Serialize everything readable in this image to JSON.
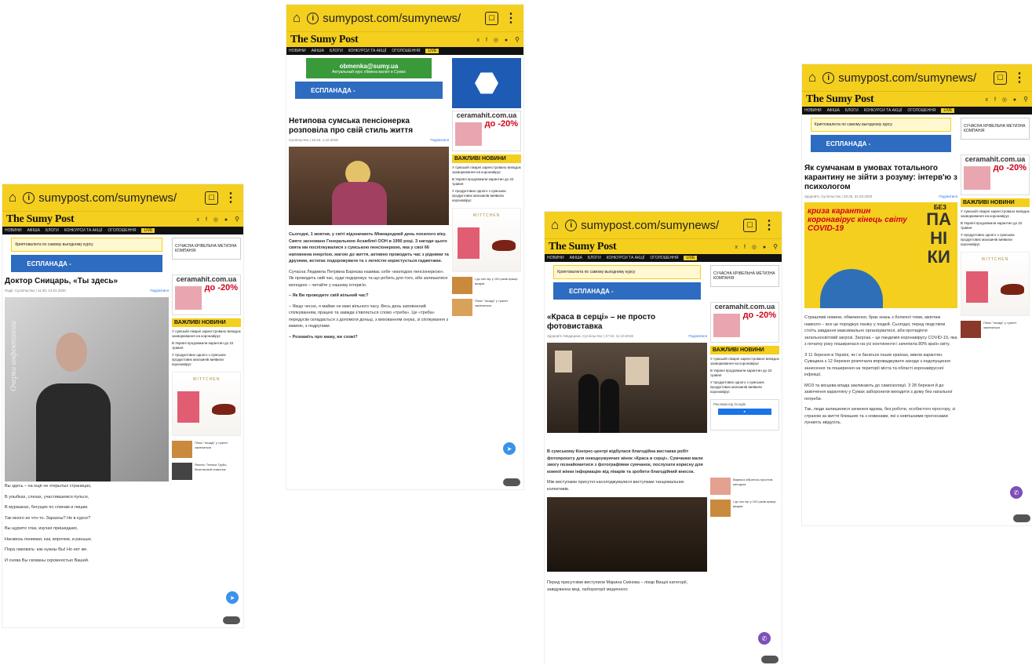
{
  "browser": {
    "url": "sumypost.com/sumynews/",
    "tab_count": " "
  },
  "site": {
    "logo": "The Sumy Post",
    "social": "х f ◎ ●",
    "nav": [
      "НОВИНИ",
      "АФІША",
      "БЛОГИ",
      "КОНКУРСИ ТА АКЦІЇ",
      "ОГОЛОШЕННЯ"
    ],
    "live": "LIVE",
    "important_news": "ВАЖЛИВІ НОВИНИ",
    "ads": {
      "obmenka": "obmenka@sumy.ua",
      "obmenka_sub": "Актуальный курс обмена валют в Сумах",
      "esplanada": "ЕСПЛАНАДА -",
      "ceramahit": "ceramahit.com.ua",
      "sale": "до -20%",
      "sale_sub": "на ВСЕ ДЛЯ ВАННОЇ КІМНАТИ",
      "sucasna": "СУЧАСНА КРІВЕЛЬНА МЕТИЗНА КОМПАНІЯ",
      "crypto": "Криптовалюта по самому выгодному курсу",
      "wittchen": "WITTCHEN"
    },
    "news_items": [
      "У сумській лікарні зареєстровано випадок захворювання на коронавірус",
      "В Україні продовжили карантин до 22 травня",
      "У продуктових одного з сумських продуктових магазинів виявили коронавірус"
    ]
  },
  "phones": [
    {
      "title": "Доктор Сницарь, «Ты здесь»",
      "meta": "Події, Суспільство | 11:30, 14.01.2020",
      "share": "Поділитися",
      "photo_caption": "Очерки инфектолога",
      "lines": [
        "Вы здесь – на ощё не открытых страницах,",
        "В улыбках, слезах, участившемся пульсе,",
        "В мурашках, бегущих по спинам и лицам.",
        "Так много их что-то. Заразны? Не в курсе?",
        "Вы щурите глаз, изучая пришедших,",
        "Насквозь понимая, как, впрочем, и раньше.",
        "Пора ликовать: как нужны Вы! Но нет же.",
        "И снова Вы скованы скромностью Вашей."
      ]
    },
    {
      "title": "Нетипова сумська пенсіонерка розповіла про свій стиль життя",
      "meta": "Суспільство | 19:15, 1.10.2019",
      "share": "Поділитися",
      "lines": [
        "Сьогодні, 1 жовтня, у світі відзначають Міжнародний день похилого віку. Свято засновано Генеральною Асамблеї ООН в 1990 році. З нагоди цього свята ми поспілкувалися з сумською пенсіонеркою, яка у свої 66 наповнена енергією, жагою до життя, активно проводить час з рідними та друзями, встигає подорожувати та з легкістю користується гаджетами.",
        "Сучасна Людмила Петрівна Барнєва називає себе «молодою пенсіонеркою». Як проводить свій час, куди подорожує та що робить для того, аби залишатися молодою – читайте у нашому інтерв'ю.",
        "– Як Ви проводите свій вільний час?",
        "– Якщо чесно, я майже не маю вільного часу. Весь день заповнений спілкуванням, працею та завжди з'являється слово «треба». Це «треба» передусім складається з допомоги доньці, з вихованням онука, зі спілкування з мамою, з подругами.",
        "– Розкажіть про маму, ви схожі?"
      ]
    },
    {
      "title": "«Краса в серці» – не просто фотовиставка",
      "meta": "Здоров'я, Медицина, Суспільство | 17:34, 11.10.2019",
      "share": "Поділитися",
      "google": "Реклама від Google",
      "lines": [
        "В сумському Конгрес-центрі відбулася благодійна виставка робіт фотопроєкту для онкодоужуючих жінок «Краса в серці». Сумчанки мали змогу познайомитися з фотографіями сумчанок, послухати корисну для кожної жінки інформацію від лікарів та зробити благодійний внесок.",
        "Між виступами присутні насолоджувалися виступами танцювальних колективів.",
        "Перед присутніми виступили Марина Смінова – лікар Вищої категорії, завідувачка мед. лабораторії медичного"
      ]
    },
    {
      "title": "Як сумчанам в умовах тотального карантину не зійти з розуму: інтерв'ю з психологом",
      "meta": "Здоров'я, Суспільство | 20:45, 31.03.2020",
      "share": "Поділитися",
      "poster": {
        "red": "криза карантин коронавірус кінець світу COVID-19",
        "bez": "БЕЗ",
        "panik": "ПА\nНІ\nКИ"
      },
      "lines": [
        "Страшливі новини, обмеження, брак знань з болючої теми, ажіотаж навколо – все це породжує паніку у людей. Сьогодні, перед людством стоїть завдання максимально організуватися, аби протидіяти загальносвітовій загрозі. Загроза – це пандемія коронавірусу COVID-19, яка з початку року поширилася на усі континенти і зачепила 80% країн світу.",
        "З 11 березня в Україні, як і в багатьох інших країнах, ввели карантин. Сумщина з 12 березня розпочала впроваджувати заходи з недопущення занесення та поширення на території міста та області коронавірусної інфекції.",
        "МОЗ та місцева влада закликають до самоізоляції. З 28 березня й до закінчення карантину у Сумах заборонили виходити з дому без нагальної потреби.",
        "Так, люди залишилися зачинені вдома, без роботи, особистого простору, зі страхом за життя близьких та з новинами, які з невтішними прогнозами лунають звідусіль."
      ]
    }
  ]
}
